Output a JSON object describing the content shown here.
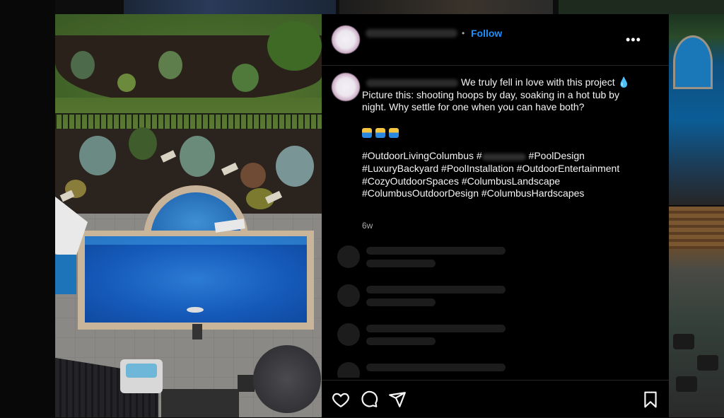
{
  "post": {
    "follow_label": "Follow",
    "more_label": "•••",
    "separator": "•",
    "caption_intro": "We truly fell in love with this project",
    "caption_drop": "💧",
    "caption_body": "Picture this: shooting hoops by day, soaking in a hot tub by night. Why settle for one when you can have both?",
    "hashtags_line1_a": "#OutdoorLivingColumbus #",
    "hashtags_line1_b": " #PoolDesign",
    "hashtags_line2": "#LuxuryBackyard #PoolInstallation #OutdoorEntertainment",
    "hashtags_line3": "#CozyOutdoorSpaces #ColumbusLandscape",
    "hashtags_line4": "#ColumbusOutdoorDesign #ColumbusHardscapes",
    "timestamp": "6w"
  },
  "icons": {
    "like": "heart-icon",
    "comment": "comment-icon",
    "share": "send-icon",
    "save": "bookmark-icon",
    "more": "more-icon",
    "emoji": "swimmer-emoji"
  },
  "colors": {
    "follow": "#1e90ff",
    "background": "#000000",
    "skeleton": "#1c1c1c"
  }
}
